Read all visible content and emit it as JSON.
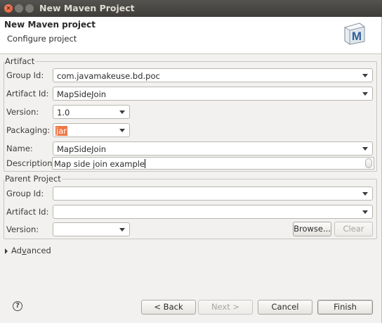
{
  "window": {
    "title": "New Maven Project",
    "close_glyph": "×",
    "min_glyph": "–",
    "max_glyph": "□"
  },
  "header": {
    "title": "New Maven project",
    "subtitle": "Configure project",
    "logo_letter": "M"
  },
  "artifact": {
    "group_label": "Artifact",
    "group_id_label": "Group Id:",
    "group_id_value": "com.javamakeuse.bd.poc",
    "artifact_id_label": "Artifact Id:",
    "artifact_id_value": "MapSideJoin",
    "version_label": "Version:",
    "version_value": "1.0",
    "packaging_label": "Packaging:",
    "packaging_value": "jar",
    "name_label": "Name:",
    "name_value": "MapSideJoin",
    "description_label": "Description:",
    "description_value": "Map side join example"
  },
  "parent": {
    "group_label": "Parent Project",
    "group_id_label": "Group Id:",
    "group_id_value": "",
    "artifact_id_label": "Artifact Id:",
    "artifact_id_value": "",
    "version_label": "Version:",
    "version_value": "",
    "browse_label": "Browse...",
    "clear_label": "Clear"
  },
  "advanced": {
    "prefix": "Ad",
    "mnemonic": "v",
    "suffix": "anced"
  },
  "footer": {
    "help_glyph": "?",
    "back_label": "< Back",
    "next_label": "Next >",
    "cancel_label": "Cancel",
    "finish_label": "Finish"
  }
}
